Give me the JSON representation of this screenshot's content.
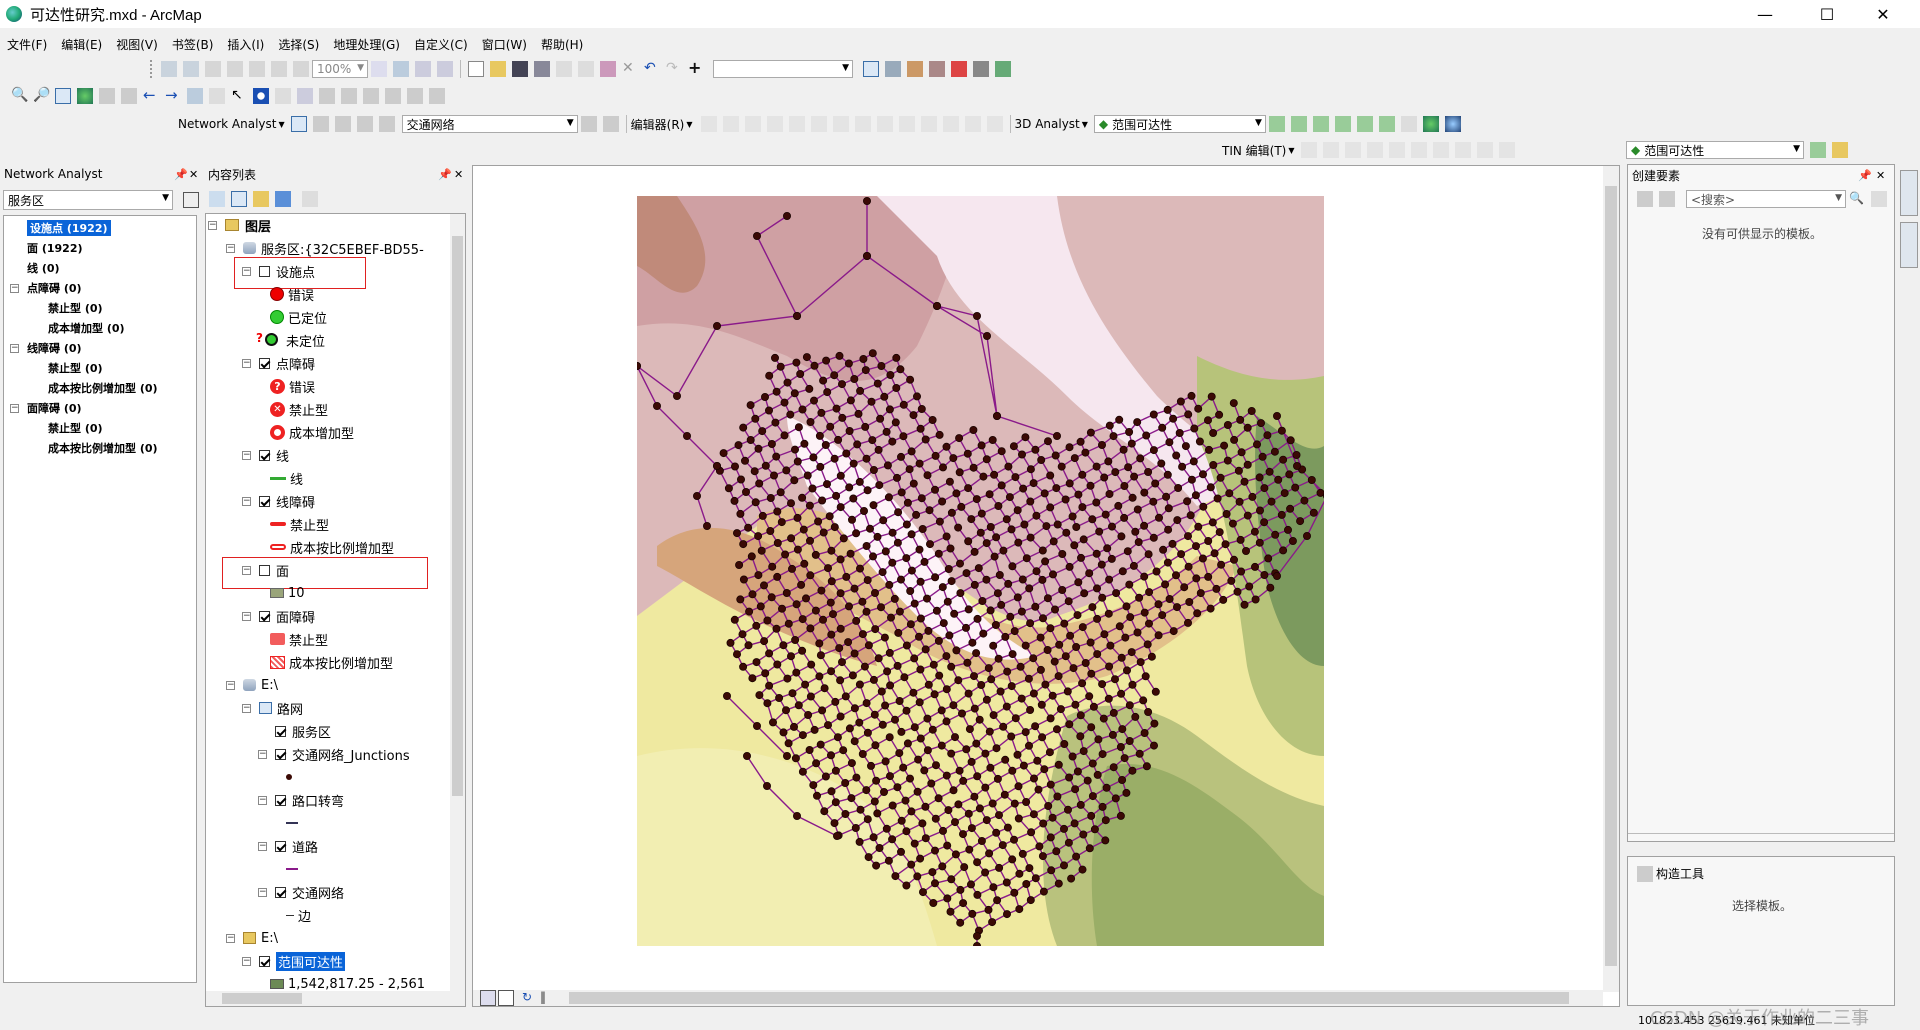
{
  "window": {
    "title": "可达性研究.mxd - ArcMap"
  },
  "menu": [
    "文件(F)",
    "编辑(E)",
    "视图(V)",
    "书签(B)",
    "插入(I)",
    "选择(S)",
    "地理处理(G)",
    "自定义(C)",
    "窗口(W)",
    "帮助(H)"
  ],
  "toolbar": {
    "zoom_value": "100%",
    "network_analyst_label": "Network Analyst",
    "network_dataset": "交通网络",
    "editor_label": "编辑器(R)",
    "analyst3d_label": "3D Analyst",
    "analyst3d_layer": "范围可达性",
    "tin_label": "TIN 编辑(T)",
    "layer_dropdown": "范围可达性"
  },
  "na_window": {
    "title": "Network Analyst",
    "selected": "服务区",
    "items": [
      {
        "label": "设施点 (1922)",
        "level": 0,
        "selected": true
      },
      {
        "label": "面 (1922)",
        "level": 0
      },
      {
        "label": "线 (0)",
        "level": 0
      },
      {
        "label": "点障碍 (0)",
        "level": 0,
        "exp": true
      },
      {
        "label": "禁止型 (0)",
        "level": 1
      },
      {
        "label": "成本增加型 (0)",
        "level": 1
      },
      {
        "label": "线障碍 (0)",
        "level": 0,
        "exp": true
      },
      {
        "label": "禁止型 (0)",
        "level": 1
      },
      {
        "label": "成本按比例增加型 (0)",
        "level": 1
      },
      {
        "label": "面障碍 (0)",
        "level": 0,
        "exp": true
      },
      {
        "label": "禁止型 (0)",
        "level": 1
      },
      {
        "label": "成本按比例增加型 (0)",
        "level": 1
      }
    ]
  },
  "toc": {
    "title": "内容列表",
    "root": "图层",
    "service_area": "服务区:{32C5EBEF-BD55-",
    "layers": {
      "facilities": "设施点",
      "err": "错误",
      "located": "已定位",
      "unlocated": "未定位",
      "point_barriers": "点障碍",
      "pb_err": "错误",
      "pb_forbid": "禁止型",
      "pb_cost": "成本增加型",
      "lines": "线",
      "lines_sym": "线",
      "line_barriers": "线障碍",
      "lb_forbid": "禁止型",
      "lb_cost": "成本按比例增加型",
      "polygons": "面",
      "poly_10": "10",
      "polygon_barriers": "面障碍",
      "pgb_forbid": "禁止型",
      "pgb_cost": "成本按比例增加型",
      "e_drive": "E:\\",
      "road_net": "路网",
      "service_area_fc": "服务区",
      "junctions": "交通网络_Junctions",
      "turns": "路口转弯",
      "roads": "道路",
      "network": "交通网络",
      "edges": "边",
      "e_drive2": "E:\\",
      "raster": "范围可达性",
      "raster_range": "1,542,817.25 - 2,561"
    }
  },
  "create_features": {
    "title": "创建要素",
    "search_placeholder": "<搜索>",
    "no_templates": "没有可供显示的模板。",
    "construct_tools": "构造工具",
    "select_template": "选择模板。"
  },
  "status": {
    "coords": "101823.453  25619.461 未知单位",
    "watermark": "CSDN @关于作业的二三事"
  },
  "colors": {
    "network_line": "#8a1a8a",
    "junction_fill": "#3b0a05",
    "highlight_box": "#e02020",
    "selection": "#0a64d8"
  }
}
